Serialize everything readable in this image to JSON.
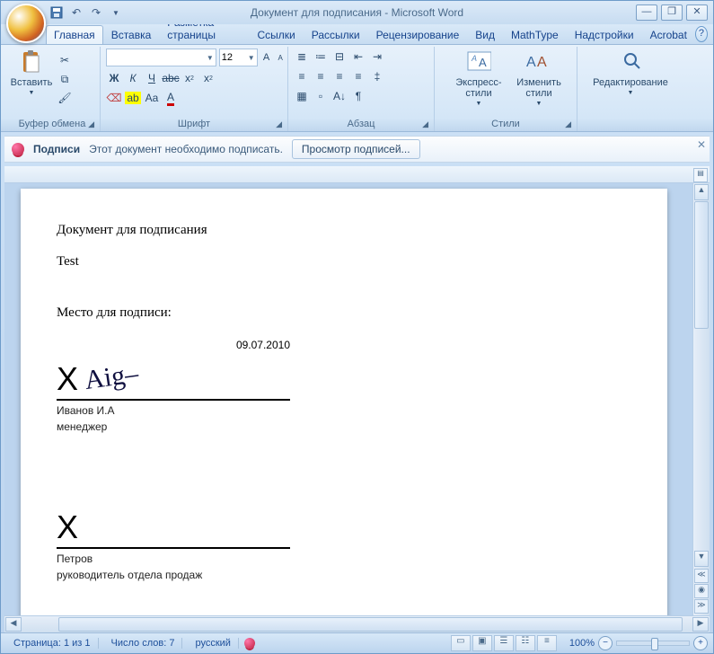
{
  "title": "Документ для подписания - Microsoft Word",
  "tabs": {
    "home": "Главная",
    "insert": "Вставка",
    "pagelayout": "Разметка страницы",
    "references": "Ссылки",
    "mailings": "Рассылки",
    "review": "Рецензирование",
    "view": "Вид",
    "mathtype": "MathType",
    "addins": "Надстройки",
    "acrobat": "Acrobat"
  },
  "ribbon": {
    "clipboard": {
      "label": "Буфер обмена",
      "paste": "Вставить"
    },
    "font": {
      "label": "Шрифт",
      "family": "",
      "size": "12"
    },
    "paragraph": {
      "label": "Абзац"
    },
    "styles": {
      "label": "Стили",
      "quick": "Экспресс-стили",
      "change": "Изменить\nстили"
    },
    "editing": {
      "label": "Редактирование"
    }
  },
  "msgbar": {
    "label": "Подписи",
    "text": "Этот документ необходимо подписать.",
    "button": "Просмотр подписей..."
  },
  "document": {
    "heading": "Документ для подписания",
    "body": "Test",
    "siglabel": "Место для подписи:",
    "date": "09.07.2010",
    "sig1": {
      "name": "Иванов И.А",
      "role": "менеджер"
    },
    "sig2": {
      "name": "Петров",
      "role": "руководитель отдела продаж"
    }
  },
  "status": {
    "page": "Страница: 1 из 1",
    "words": "Число слов: 7",
    "lang": "русский",
    "zoom": "100%"
  }
}
